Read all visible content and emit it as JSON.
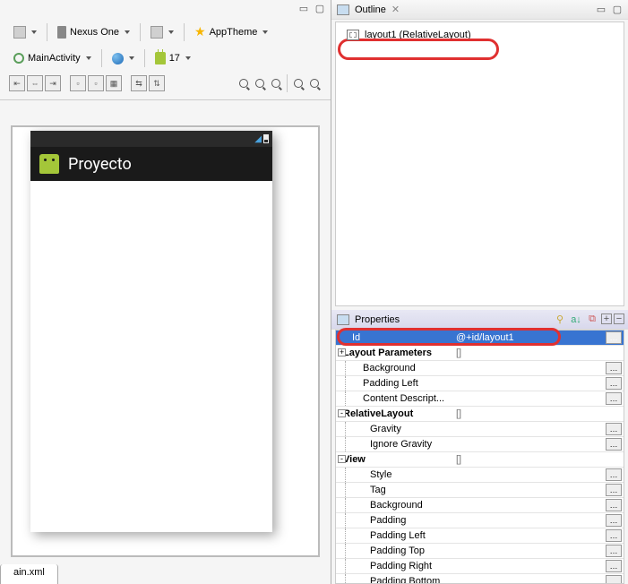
{
  "left": {
    "device": "Nexus One",
    "theme": "AppTheme",
    "activity": "MainActivity",
    "api": "17",
    "file_tab": "ain.xml"
  },
  "preview": {
    "app_title": "Proyecto"
  },
  "outline": {
    "title": "Outline",
    "items": [
      {
        "label": "layout1 (RelativeLayout)"
      }
    ]
  },
  "properties": {
    "title": "Properties",
    "rows": [
      {
        "name": "Id",
        "value": "@+id/layout1",
        "selected": true,
        "btn": true
      },
      {
        "name": "Layout Parameters",
        "value": "[]",
        "category": true,
        "exp": "+"
      },
      {
        "name": "Background",
        "value": "",
        "indent": 1,
        "btn": true
      },
      {
        "name": "Padding Left",
        "value": "",
        "indent": 1,
        "btn": true
      },
      {
        "name": "Content Descript...",
        "value": "",
        "indent": 1,
        "btn": true
      },
      {
        "name": "RelativeLayout",
        "value": "[]",
        "category": true,
        "exp": "-"
      },
      {
        "name": "Gravity",
        "value": "",
        "indent": 2,
        "btn": true
      },
      {
        "name": "Ignore Gravity",
        "value": "",
        "indent": 2,
        "btn": true
      },
      {
        "name": "View",
        "value": "[]",
        "category": true,
        "exp": "-"
      },
      {
        "name": "Style",
        "value": "",
        "indent": 2,
        "btn": true
      },
      {
        "name": "Tag",
        "value": "",
        "indent": 2,
        "btn": true
      },
      {
        "name": "Background",
        "value": "",
        "indent": 2,
        "btn": true
      },
      {
        "name": "Padding",
        "value": "",
        "indent": 2,
        "btn": true
      },
      {
        "name": "Padding Left",
        "value": "",
        "indent": 2,
        "btn": true
      },
      {
        "name": "Padding Top",
        "value": "",
        "indent": 2,
        "btn": true
      },
      {
        "name": "Padding Right",
        "value": "",
        "indent": 2,
        "btn": true
      },
      {
        "name": "Padding Bottom",
        "value": "",
        "indent": 2,
        "btn": true
      }
    ]
  }
}
